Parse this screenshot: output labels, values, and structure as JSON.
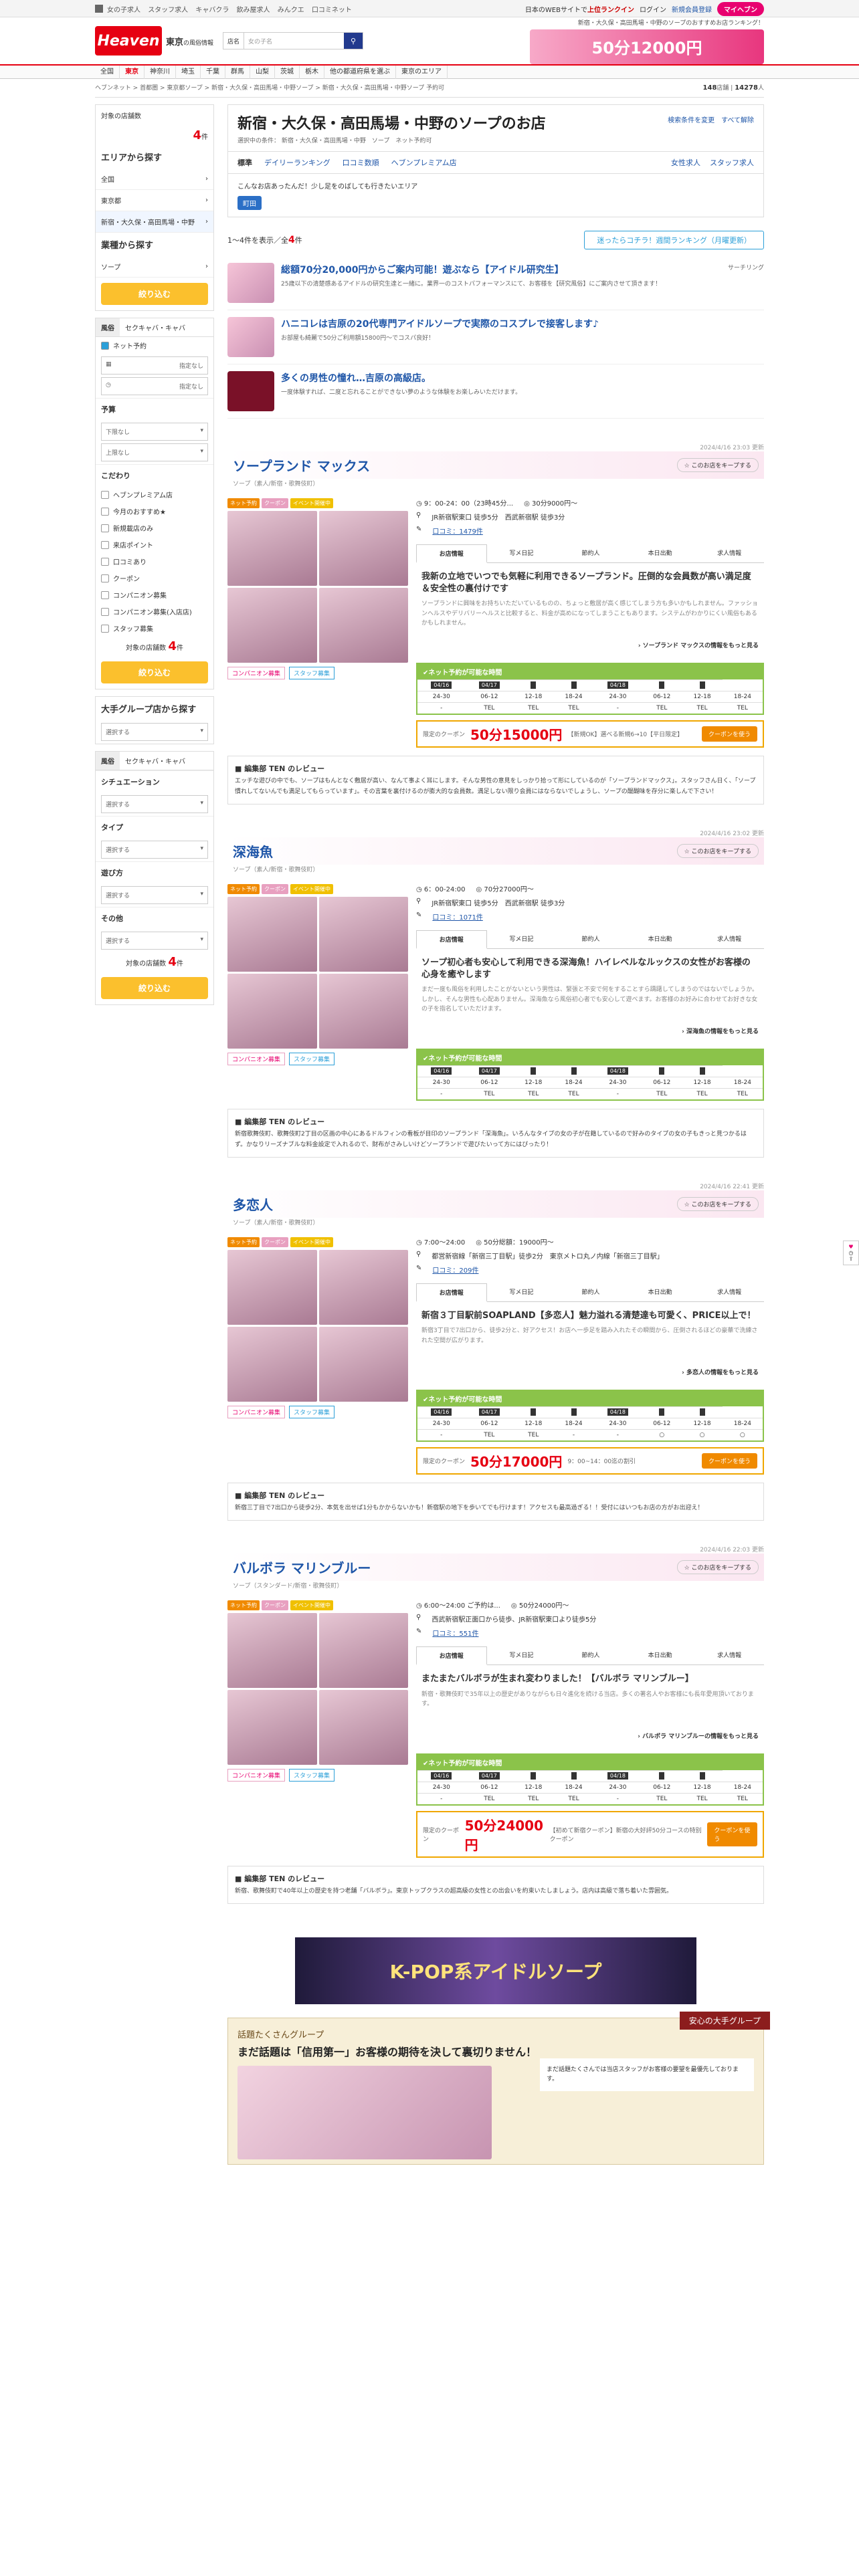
{
  "topbar": {
    "links": [
      "女の子求人",
      "スタッフ求人",
      "キャバクラ",
      "飲み屋求人",
      "みんクエ",
      "口コミネット"
    ],
    "right": {
      "note_pre": "日本のWEBサイトで",
      "note_hl": "上位ランクイン",
      "login": "ログイン",
      "register": "新規会員登録",
      "mypage": "マイヘブン"
    }
  },
  "header": {
    "logo": "Heaven",
    "area": "東京",
    "area_sub": "の風俗情報",
    "search_select": "店名",
    "search_placeholder": "女の子名",
    "note": "新宿・大久保・高田馬場・中野のソープのおすすめお店ランキング！",
    "banner": "50分12000円"
  },
  "nav": [
    "全国",
    "東京",
    "神奈川",
    "埼玉",
    "千葉",
    "群馬",
    "山梨",
    "茨城",
    "栃木",
    "他の都道府県を選ぶ",
    "東京のエリア"
  ],
  "breadcrumb": "ヘブンネット > 首都圏 > 東京都ソープ > 新宿・大久保・高田馬場・中野ソープ > 新宿・大久保・高田馬場・中野ソープ 予約可",
  "counts": {
    "shops": "148",
    "shops_unit": "店舗",
    "girls": "14278",
    "girls_unit": "人"
  },
  "sidebar": {
    "target_label": "対象の店舗数",
    "target_count": "4",
    "target_unit": "件",
    "area_title": "エリアから探す",
    "area_items": [
      "全国",
      "東京都",
      "新宿・大久保・高田馬場・中野"
    ],
    "genre_title": "業種から探す",
    "genre_item": "ソープ",
    "narrow": "絞り込む",
    "tabs": [
      "風俗",
      "セクキャバ・キャバ"
    ],
    "reserve": "ネット予約",
    "date_ph": "指定なし",
    "time_ph": "指定なし",
    "budget_title": "予算",
    "budget_min": "下限なし",
    "budget_max": "上限なし",
    "kodawari_title": "こだわり",
    "kodawari": [
      "ヘブンプレミアム店",
      "今月のおすすめ★",
      "新規載店のみ",
      "来店ポイント",
      "口コミあり",
      "クーポン",
      "コンパニオン募集",
      "コンパニオン募集(入店店)",
      "スタッフ募集"
    ],
    "group_title": "大手グループ店から探す",
    "group_select": "選択する",
    "situation": "シチュエーション",
    "type": "タイプ",
    "asobi": "遊び方",
    "other": "その他",
    "select": "選択する"
  },
  "main": {
    "title": "新宿・大久保・高田馬場・中野のソープのお店",
    "sub_label": "選択中の条件：",
    "sub_val": "新宿・大久保・高田馬場・中野　ソープ　ネット予約可",
    "change": "検索条件を変更",
    "reset": "すべて解除",
    "tabs": [
      "標準",
      "デイリーランキング",
      "口コミ数順",
      "ヘブンプレミアム店",
      "女性求人",
      "スタッフ求人"
    ],
    "area_q": "こんなお店あったんだ！少し足をのばしても行きたいエリア",
    "area_pill": "町田",
    "result_pre": "1～4件を表示／全",
    "result_num": "4",
    "result_post": "件",
    "rank_btn": "迷ったらコチラ！週間ランキング（月曜更新）"
  },
  "promos": [
    {
      "title": "総額70分20,000円からご案内可能！遊ぶなら【アイドル研究生】",
      "desc": "25歳以下の清楚感あるアイドルの研究生達と一緒に。業界一のコストパフォーマンスにて、お客様を【研究風俗】にご案内させて頂きます！",
      "tag": "サーチリング"
    },
    {
      "title": "ハニコレは吉原の20代専門アイドルソープで実際のコスプレで接客します♪",
      "desc": "お部屋も綺麗で50分ご利用額15800円〜でコスパ良好！",
      "tag": ""
    },
    {
      "title": "多くの男性の憧れ…吉原の高級店。",
      "desc": "一度体験すれば、二度と忘れることができない夢のような体験をお楽しみいただけます。",
      "tag": ""
    }
  ],
  "shops": [
    {
      "date": "2024/4/16 23:03 更新",
      "name": "ソープランド マックス",
      "genre": "ソープ（素人/新宿・歌舞伎町）",
      "hours": "9：00-24：00（23時45分...",
      "price": "30分9000円～",
      "access": "JR新宿駅東口 徒歩5分　西武新宿駅 徒歩3分",
      "kuchi": "口コミ：1479件",
      "pr_h": "我新の立地でいつでも気軽に利用できるソープランド。圧倒的な会員数が高い満足度＆安全性の裏付けです",
      "pr_p": "ソープランドに興味をお持ちいただいているものの、ちょっと敷居が高く感じてしまう方も多いかもしれません。ファッションヘルスやデリバリーヘルスと比較すると、料金が高めになってしまうこともあります。システムがわかりにくい風俗もあるかもしれません。",
      "more": "ソープランド マックスの情報をもっと見る",
      "days": [
        "04/16",
        "04/17",
        "",
        "",
        "04/18",
        "",
        ""
      ],
      "slots": [
        "24-30",
        "06-12",
        "12-18",
        "18-24",
        "24-30",
        "06-12",
        "12-18",
        "18-24"
      ],
      "vals": [
        "-",
        "TEL",
        "TEL",
        "TEL",
        "-",
        "TEL",
        "TEL",
        "TEL"
      ],
      "coupon": "50分15000円",
      "coupon_sm": "【新規OK】選べる新規6→10【平日限定】",
      "review": "エッチな遊びの中でも、ソープはもんとなく敷居が高い、なんて事よく耳にします。そんな男性の意見をしっかり拾って形にしているのが「ソープランドマックス」。スタッフさん日く、「ソープ慣れしてないんでも満足してもらっています」。その言葉を裏付けるのが膨大的な会員数。満足しない限り会員にはならないでしょうし、ソープの醍醐味を存分に楽しんで下さい！"
    },
    {
      "date": "2024/4/16 23:02 更新",
      "name": "深海魚",
      "genre": "ソープ（素人/新宿・歌舞伎町）",
      "hours": "6：00-24:00",
      "price": "70分27000円～",
      "access": "JR新宿駅東口 徒歩5分　西武新宿駅 徒歩3分",
      "kuchi": "口コミ：1071件",
      "pr_h": "ソープ初心者も安心して利用できる深海魚！ハイレベルなルックスの女性がお客様の心身を癒やします",
      "pr_p": "まだ一度も風俗を利用したことがないという男性は、緊張と不安で何をすることすら躊躇してしまうのではないでしょうか。しかし、そんな男性も心配ありません。深海魚なら風俗初心者でも安心して遊べます。お客様のお好みに合わせてお好きな女の子を指名していただけます。",
      "more": "深海魚の情報をもっと見る",
      "days": [
        "04/16",
        "04/17",
        "",
        "",
        "04/18",
        "",
        ""
      ],
      "slots": [
        "24-30",
        "06-12",
        "12-18",
        "18-24",
        "24-30",
        "06-12",
        "12-18",
        "18-24"
      ],
      "vals": [
        "-",
        "TEL",
        "TEL",
        "TEL",
        "-",
        "TEL",
        "TEL",
        "TEL"
      ],
      "coupon": "",
      "coupon_sm": "",
      "review": "新宿歌舞伎町、歌舞伎町2丁目の区画の中心にあるドルフィンの看板が目印のソープランド「深海魚」。いろんなタイプの女の子が在籍しているので好みのタイプの女の子もきっと見つかるはず。かなりリーズナブルな料金設定で入れるので、財布がさみしいけどソープランドで遊びたいって方にはぴったり！"
    },
    {
      "date": "2024/4/16 22:41 更新",
      "name": "多恋人",
      "genre": "ソープ（素人/新宿・歌舞伎町）",
      "hours": "7:00〜24:00",
      "price": "50分総額：19000円～",
      "access": "都営新宿線「新宿三丁目駅」徒歩2分　東京メトロ丸ノ内線「新宿三丁目駅」",
      "kuchi": "口コミ：209件",
      "pr_h": "新宿３丁目駅前SOAPLAND【多恋人】魅力溢れる清楚達も可愛く、PRICE以上で！",
      "pr_p": "新宿3丁目で7出口から、徒歩2分と、好アクセス！お店へ一歩足を踏み入れたその瞬間から、圧倒されるほどの豪華で洗練された空間が広がります。",
      "more": "多恋人の情報をもっと見る",
      "days": [
        "04/16",
        "04/17",
        "",
        "",
        "04/18",
        "",
        ""
      ],
      "slots": [
        "24-30",
        "06-12",
        "12-18",
        "18-24",
        "24-30",
        "06-12",
        "12-18",
        "18-24"
      ],
      "vals": [
        "-",
        "TEL",
        "TEL",
        "-",
        "-",
        "○",
        "○",
        "○"
      ],
      "coupon": "50分17000円",
      "coupon_sm": "9：00~14：00迄の割引",
      "review": "新宿三丁目で7出口から徒歩2分、本気を出せば1分もかからないかも！新宿駅の地下を歩いてでも行けます！アクセスも最高過ぎる！！受付にはいつもお店の方がお出迎え！"
    },
    {
      "date": "2024/4/16 22:03 更新",
      "name": "バルボラ マリンブルー",
      "genre": "ソープ（スタンダード/新宿・歌舞伎町）",
      "hours": "6:00〜24:00 ご予約は...",
      "price": "50分24000円～",
      "access": "西武新宿駅正面口から徒歩、JR新宿駅東口より徒歩5分",
      "kuchi": "口コミ：551件",
      "pr_h": "またまたバルボラが生まれ変わりました！【バルボラ マリンブルー】",
      "pr_p": "新宿・歌舞伎町で35年以上の歴史がありながらも日々進化を続ける当店。多くの著名人やお客様にも長年愛用頂いております。",
      "more": "バルボラ マリンブルーの情報をもっと見る",
      "days": [
        "04/16",
        "04/17",
        "",
        "",
        "04/18",
        "",
        ""
      ],
      "slots": [
        "24-30",
        "06-12",
        "12-18",
        "18-24",
        "24-30",
        "06-12",
        "12-18",
        "18-24"
      ],
      "vals": [
        "-",
        "TEL",
        "TEL",
        "TEL",
        "-",
        "TEL",
        "TEL",
        "TEL"
      ],
      "coupon": "50分24000円",
      "coupon_sm": "【初めて新宿クーポン】新宿の大好評50分コースの特別クーポン",
      "review": "新宿、歌舞伎町で40年以上の歴史を持つ老舗「バルボラ」。東京トップクラスの超高級の女性との出会いを約束いたしましょう。店内は高級で落ち着いた雰囲気。"
    }
  ],
  "labels": {
    "companion": "コンパニオン募集",
    "staff": "スタッフ募集",
    "review_head": "編集部 TEN のレビュー",
    "fav": "このお店をキープする",
    "reserve": "ネット予約が可能な時間",
    "tabs": [
      "お店情報",
      "写メ日記",
      "節約人",
      "本日出勤",
      "求人情報"
    ],
    "coupon_lbl": "限定のクーポン",
    "coupon_cta": "クーポンを使う"
  },
  "bottom": {
    "banner": "K-POP系アイドルソープ",
    "group_head": "話題たくさんグループ",
    "group_title": "まだ話題は「信用第一」お客様の期待を決して裏切りません！",
    "group_badge": "安心の大手グループ",
    "group_text": "まだ話題たくさんでは当店スタッフがお客様の要望を最優先しております。"
  }
}
